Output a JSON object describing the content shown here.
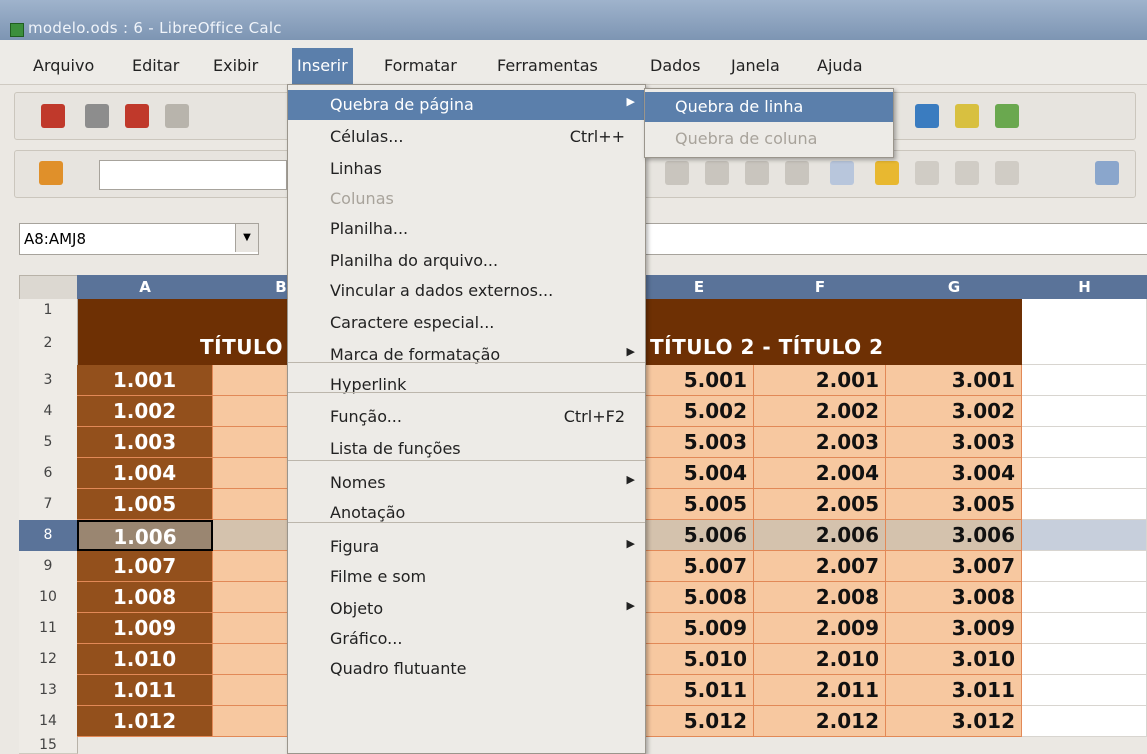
{
  "window": {
    "title": "modelo.ods : 6 - LibreOffice Calc"
  },
  "menubar": {
    "items": [
      "Arquivo",
      "Editar",
      "Exibir",
      "Inserir",
      "Formatar",
      "Ferramentas",
      "Dados",
      "Janela",
      "Ajuda"
    ],
    "active": "Inserir"
  },
  "namebox": {
    "value": "A8:AMJ8"
  },
  "columns": [
    "A",
    "B",
    "E",
    "F",
    "G",
    "H"
  ],
  "rows": [
    "1",
    "2",
    "3",
    "4",
    "5",
    "6",
    "7",
    "8",
    "9",
    "10",
    "11",
    "12",
    "13",
    "14",
    "15"
  ],
  "sheet": {
    "title_left": "TÍTULO",
    "title_right": "TÍTULO 2 - TÍTULO 2",
    "colA": [
      "1.001",
      "1.002",
      "1.003",
      "1.004",
      "1.005",
      "1.006",
      "1.007",
      "1.008",
      "1.009",
      "1.010",
      "1.011",
      "1.012"
    ],
    "colE": [
      "5.001",
      "5.002",
      "5.003",
      "5.004",
      "5.005",
      "5.006",
      "5.007",
      "5.008",
      "5.009",
      "5.010",
      "5.011",
      "5.012"
    ],
    "colF": [
      "2.001",
      "2.002",
      "2.003",
      "2.004",
      "2.005",
      "2.006",
      "2.007",
      "2.008",
      "2.009",
      "2.010",
      "2.011",
      "2.012"
    ],
    "colG": [
      "3.001",
      "3.002",
      "3.003",
      "3.004",
      "3.005",
      "3.006",
      "3.007",
      "3.008",
      "3.009",
      "3.010",
      "3.011",
      "3.012"
    ],
    "selected_row": "8"
  },
  "insert_menu": {
    "items": [
      {
        "label": "Quebra de página",
        "shortcut": "",
        "submenu": true,
        "highlight": true,
        "disabled": false
      },
      {
        "label": "Células...",
        "shortcut": "Ctrl++",
        "submenu": false,
        "highlight": false,
        "disabled": false
      },
      {
        "label": "Linhas",
        "shortcut": "",
        "submenu": false,
        "highlight": false,
        "disabled": false
      },
      {
        "label": "Colunas",
        "shortcut": "",
        "submenu": false,
        "highlight": false,
        "disabled": true
      },
      {
        "label": "Planilha...",
        "shortcut": "",
        "submenu": false,
        "highlight": false,
        "disabled": false
      },
      {
        "label": "Planilha do arquivo...",
        "shortcut": "",
        "submenu": false,
        "highlight": false,
        "disabled": false
      },
      {
        "label": "Vincular a dados externos...",
        "shortcut": "",
        "submenu": false,
        "highlight": false,
        "disabled": false
      },
      {
        "label": "Caractere especial...",
        "shortcut": "",
        "submenu": false,
        "highlight": false,
        "disabled": false
      },
      {
        "label": "Marca de formatação",
        "shortcut": "",
        "submenu": true,
        "highlight": false,
        "disabled": false
      },
      {
        "label": "Hyperlink",
        "shortcut": "",
        "submenu": false,
        "highlight": false,
        "disabled": false
      },
      {
        "label": "Função...",
        "shortcut": "Ctrl+F2",
        "submenu": false,
        "highlight": false,
        "disabled": false
      },
      {
        "label": "Lista de funções",
        "shortcut": "",
        "submenu": false,
        "highlight": false,
        "disabled": false
      },
      {
        "label": "Nomes",
        "shortcut": "",
        "submenu": true,
        "highlight": false,
        "disabled": false
      },
      {
        "label": "Anotação",
        "shortcut": "",
        "submenu": false,
        "highlight": false,
        "disabled": false
      },
      {
        "label": "Figura",
        "shortcut": "",
        "submenu": true,
        "highlight": false,
        "disabled": false
      },
      {
        "label": "Filme e som",
        "shortcut": "",
        "submenu": false,
        "highlight": false,
        "disabled": false
      },
      {
        "label": "Objeto",
        "shortcut": "",
        "submenu": true,
        "highlight": false,
        "disabled": false
      },
      {
        "label": "Gráfico...",
        "shortcut": "",
        "submenu": false,
        "highlight": false,
        "disabled": false
      },
      {
        "label": "Quadro flutuante",
        "shortcut": "",
        "submenu": false,
        "highlight": false,
        "disabled": false
      }
    ]
  },
  "page_break_submenu": {
    "items": [
      {
        "label": "Quebra de linha",
        "highlight": true,
        "disabled": false
      },
      {
        "label": "Quebra de coluna",
        "highlight": false,
        "disabled": true
      }
    ]
  },
  "toolbar_icons": [
    "document-icon",
    "open-folder-icon",
    "save-icon",
    "email-icon",
    "navigator-icon",
    "sort-ascending-icon",
    "sort-descending-icon",
    "styles-icon",
    "align-left-icon",
    "align-center-icon",
    "align-right-icon",
    "justify-icon",
    "merge-cells-icon",
    "currency-icon",
    "percent-icon",
    "add-decimal-icon",
    "remove-decimal-icon",
    "indent-icon"
  ],
  "colors": {
    "title_band": "#6e3004",
    "col_a": "#93501c",
    "value_cells": "#f7c8a0",
    "highlight": "#5b7fab"
  }
}
